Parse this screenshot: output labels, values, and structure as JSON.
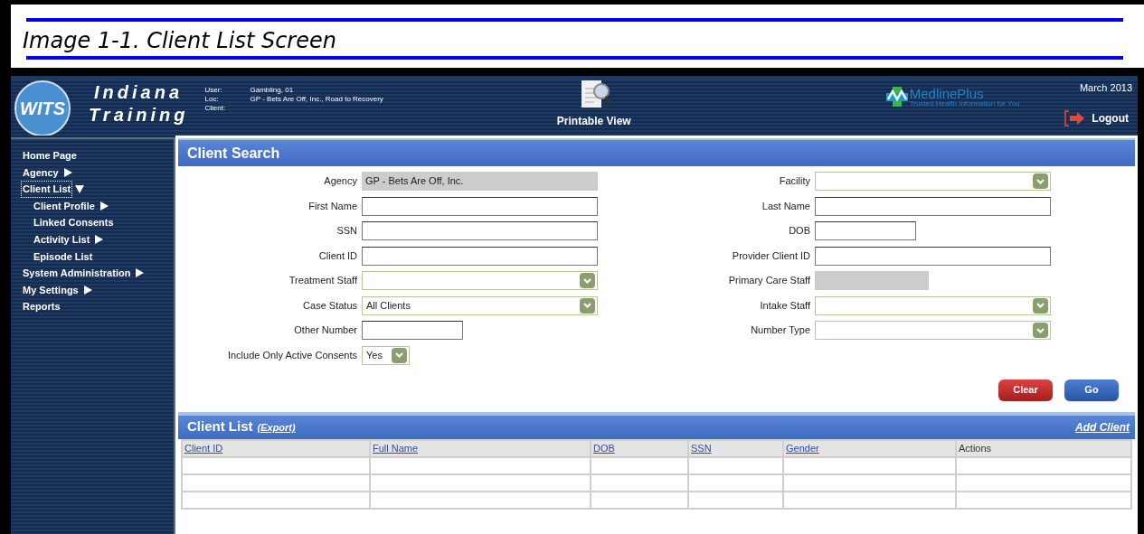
{
  "caption": "Image 1-1. Client List Screen",
  "header": {
    "logo_badge": "WITS",
    "brand_lines": [
      "Indiana",
      "Training"
    ],
    "session": [
      {
        "label": "User:",
        "value": "Gambling, 01"
      },
      {
        "label": "Loc:",
        "value": "GP - Bets Are Off, Inc., Road to Recovery"
      },
      {
        "label": "Client:"
      }
    ],
    "printable_view": "Printable View",
    "partner_logo": {
      "name": "MedlinePlus",
      "tagline": "Trusted Health Information for You"
    },
    "date": "March 2013",
    "logout": "Logout"
  },
  "sidebar": {
    "items": [
      {
        "label": "Home Page",
        "kind": "leaf",
        "selected": false
      },
      {
        "label": "Agency",
        "kind": "menu",
        "expanded": false,
        "selected": false
      },
      {
        "label": "Client List",
        "kind": "menu",
        "expanded": true,
        "selected": true,
        "children": [
          {
            "label": "Client Profile",
            "kind": "menu",
            "expanded": false,
            "selected": false
          },
          {
            "label": "Linked Consents",
            "kind": "leaf",
            "selected": false
          },
          {
            "label": "Activity List",
            "kind": "menu",
            "expanded": false,
            "selected": false
          },
          {
            "label": "Episode List",
            "kind": "leaf",
            "selected": false
          }
        ]
      },
      {
        "label": "System Administration",
        "kind": "menu",
        "expanded": false,
        "selected": false
      },
      {
        "label": "My Settings",
        "kind": "menu",
        "expanded": false,
        "selected": false
      },
      {
        "label": "Reports",
        "kind": "leaf",
        "selected": false
      }
    ]
  },
  "search": {
    "title": "Client Search",
    "left": [
      {
        "label": "Agency",
        "kind": "readonly",
        "value": "GP - Bets Are Off, Inc."
      },
      {
        "label": "First Name",
        "kind": "text"
      },
      {
        "label": "SSN",
        "kind": "text"
      },
      {
        "label": "Client ID",
        "kind": "text"
      },
      {
        "label": "Treatment Staff",
        "kind": "select"
      },
      {
        "label": "Case Status",
        "kind": "select",
        "value": "All Clients"
      },
      {
        "label": "Other Number",
        "kind": "short"
      },
      {
        "label": "Include Only Active Consents",
        "kind": "mini-select",
        "value": "Yes"
      }
    ],
    "right": [
      {
        "label": "Facility",
        "kind": "select"
      },
      {
        "label": "Last Name",
        "kind": "text"
      },
      {
        "label": "DOB",
        "kind": "short"
      },
      {
        "label": "Provider Client ID",
        "kind": "text"
      },
      {
        "label": "Primary Care Staff",
        "kind": "readonly-short"
      },
      {
        "label": "Intake Staff",
        "kind": "select"
      },
      {
        "label": "Number Type",
        "kind": "select"
      }
    ],
    "buttons": [
      {
        "label": "Clear",
        "kind": "danger"
      },
      {
        "label": "Go",
        "kind": "primary"
      }
    ]
  },
  "client_list": {
    "title": "Client List",
    "export": "(Export)",
    "add": "Add Client",
    "columns": [
      {
        "label": "Client ID",
        "sortable": true
      },
      {
        "label": "Full Name",
        "sortable": true
      },
      {
        "label": "DOB",
        "sortable": true
      },
      {
        "label": "SSN",
        "sortable": true
      },
      {
        "label": "Gender",
        "sortable": true
      },
      {
        "label": "Actions",
        "sortable": false
      }
    ]
  }
}
